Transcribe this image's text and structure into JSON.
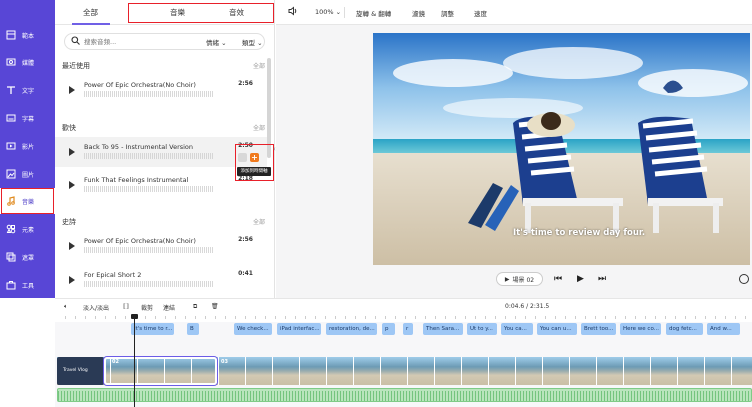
{
  "sidebar": {
    "items": [
      {
        "label": "範本",
        "icon": "template-icon"
      },
      {
        "label": "媒體",
        "icon": "media-icon"
      },
      {
        "label": "文字",
        "icon": "text-icon"
      },
      {
        "label": "字幕",
        "icon": "subtitle-icon"
      },
      {
        "label": "影片",
        "icon": "video-icon"
      },
      {
        "label": "圖片",
        "icon": "image-icon"
      },
      {
        "label": "音樂",
        "icon": "music-icon"
      },
      {
        "label": "元素",
        "icon": "elements-icon"
      },
      {
        "label": "遮罩",
        "icon": "overlay-icon"
      },
      {
        "label": "工具",
        "icon": "tools-icon"
      }
    ],
    "active": "音樂"
  },
  "audio_panel": {
    "tabs": [
      "全部",
      "音樂",
      "音效"
    ],
    "search_placeholder": "搜索音頻...",
    "filter_mood": "情緒",
    "filter_genre": "類型",
    "sections": [
      {
        "title": "最近使用",
        "more": "全部",
        "tracks": [
          {
            "name": "Power Of Epic Orchestra(No Choir)",
            "duration": "2:56"
          }
        ]
      },
      {
        "title": "歡快",
        "more": "全部",
        "tracks": [
          {
            "name": "Back To 95 - Instrumental Version",
            "duration": "2:50"
          },
          {
            "name": "Funk That Feelings Instrumental",
            "duration": "2:18"
          }
        ]
      },
      {
        "title": "史詩",
        "more": "全部",
        "tracks": [
          {
            "name": "Power Of Epic Orchestra(No Choir)",
            "duration": "2:56"
          },
          {
            "name": "For Epical Short 2",
            "duration": "0:41"
          }
        ]
      }
    ],
    "tooltip": "添加到時間軸"
  },
  "toolbar": {
    "zoom": "100%",
    "items": [
      "旋轉 & 翻轉",
      "濾鏡",
      "調整",
      "速度"
    ]
  },
  "preview": {
    "caption": "It's time to review day four.",
    "scene_label": "場景 02"
  },
  "timeline_toolbar": {
    "fade": "淡入/淡出",
    "crop": "裁剪",
    "link": "連結",
    "timecode": "0:04.6 / 2:31.5"
  },
  "subtitles": [
    "It's time to r...",
    "B",
    "We check...",
    "iPad interfac...",
    "restoration, de...",
    "p",
    "r",
    "Then Sara...",
    "Ut to y...",
    "You ca...",
    "You can u...",
    "Brett too...",
    "Here we co...",
    "dog fetc...",
    "And w..."
  ],
  "clips": {
    "intro_label": "Travel Vlog",
    "numbers": [
      "02",
      "03"
    ]
  },
  "colors": {
    "sidebar": "#5846d6",
    "accent": "#7060e6",
    "highlight_box": "#e8202a",
    "add_button": "#f07a1e"
  }
}
